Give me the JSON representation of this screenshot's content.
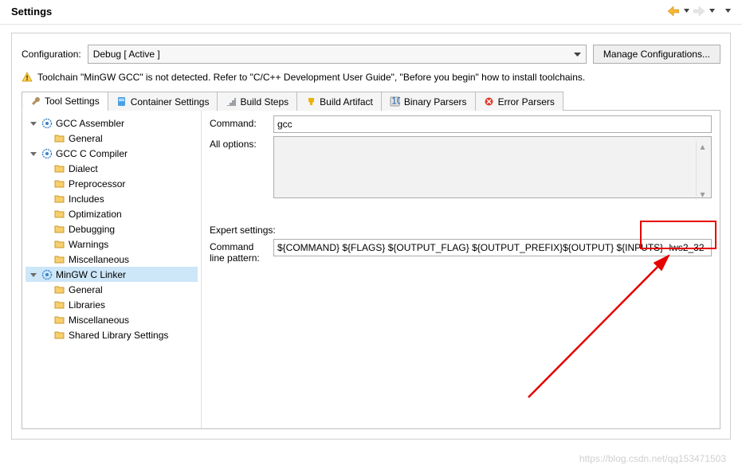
{
  "header": {
    "title": "Settings"
  },
  "config": {
    "label": "Configuration:",
    "selected": "Debug  [ Active ]",
    "manage_btn": "Manage Configurations..."
  },
  "warning": "Toolchain \"MinGW GCC\" is not detected. Refer to \"C/C++ Development User Guide\", \"Before you begin\" how to install toolchains.",
  "tabs": {
    "tool_settings": "Tool Settings",
    "container_settings": "Container Settings",
    "build_steps": "Build Steps",
    "build_artifact": "Build Artifact",
    "binary_parsers": "Binary Parsers",
    "error_parsers": "Error Parsers"
  },
  "tree": {
    "gcc_assembler": "GCC Assembler",
    "asm_general": "General",
    "gcc_c_compiler": "GCC C Compiler",
    "dialect": "Dialect",
    "preprocessor": "Preprocessor",
    "includes": "Includes",
    "optimization": "Optimization",
    "debugging": "Debugging",
    "warnings": "Warnings",
    "miscellaneous": "Miscellaneous",
    "mingw_c_linker": "MinGW C Linker",
    "linker_general": "General",
    "libraries": "Libraries",
    "linker_misc": "Miscellaneous",
    "shared_lib": "Shared Library Settings"
  },
  "form": {
    "command_label": "Command:",
    "command_value": "gcc",
    "all_options_label": "All options:",
    "all_options_value": "",
    "expert_label": "Expert settings:",
    "pattern_label_l1": "Command",
    "pattern_label_l2": "line pattern:",
    "pattern_value": "${COMMAND} ${FLAGS} ${OUTPUT_FLAG} ${OUTPUT_PREFIX}${OUTPUT} ${INPUTS} -lws2_32"
  },
  "watermark": "https://blog.csdn.net/qq153471503"
}
